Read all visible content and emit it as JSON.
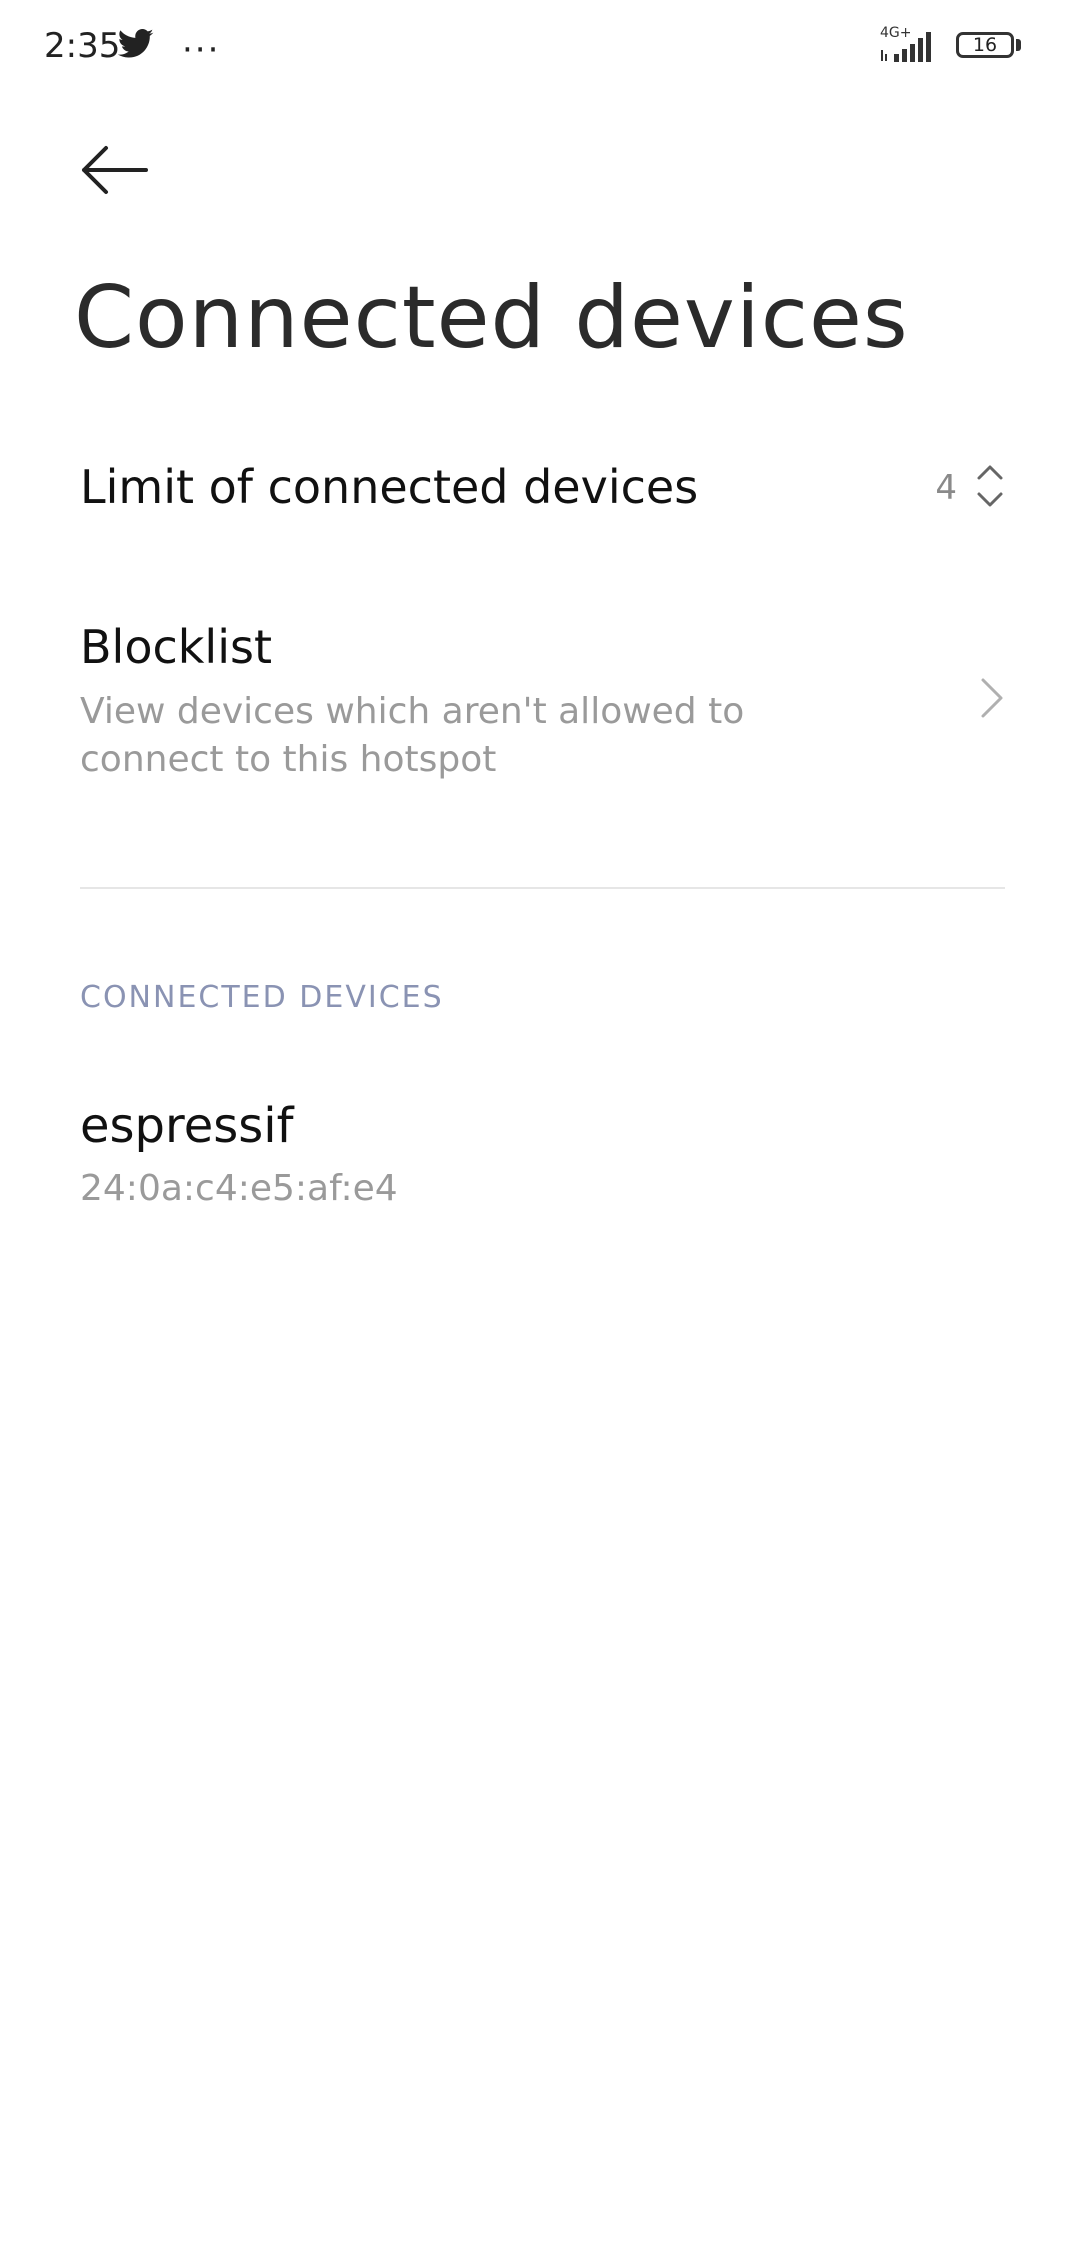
{
  "status_bar": {
    "time": "2:35",
    "more": "···",
    "network": "4G+",
    "battery": "16"
  },
  "header": {
    "title": "Connected devices"
  },
  "limit": {
    "label": "Limit of connected devices",
    "value": "4"
  },
  "blocklist": {
    "title": "Blocklist",
    "description": "View devices which aren't allowed to connect to this hotspot"
  },
  "connected_section": {
    "header": "CONNECTED DEVICES",
    "devices": [
      {
        "name": "espressif",
        "mac": "24:0a:c4:e5:af:e4"
      }
    ]
  }
}
